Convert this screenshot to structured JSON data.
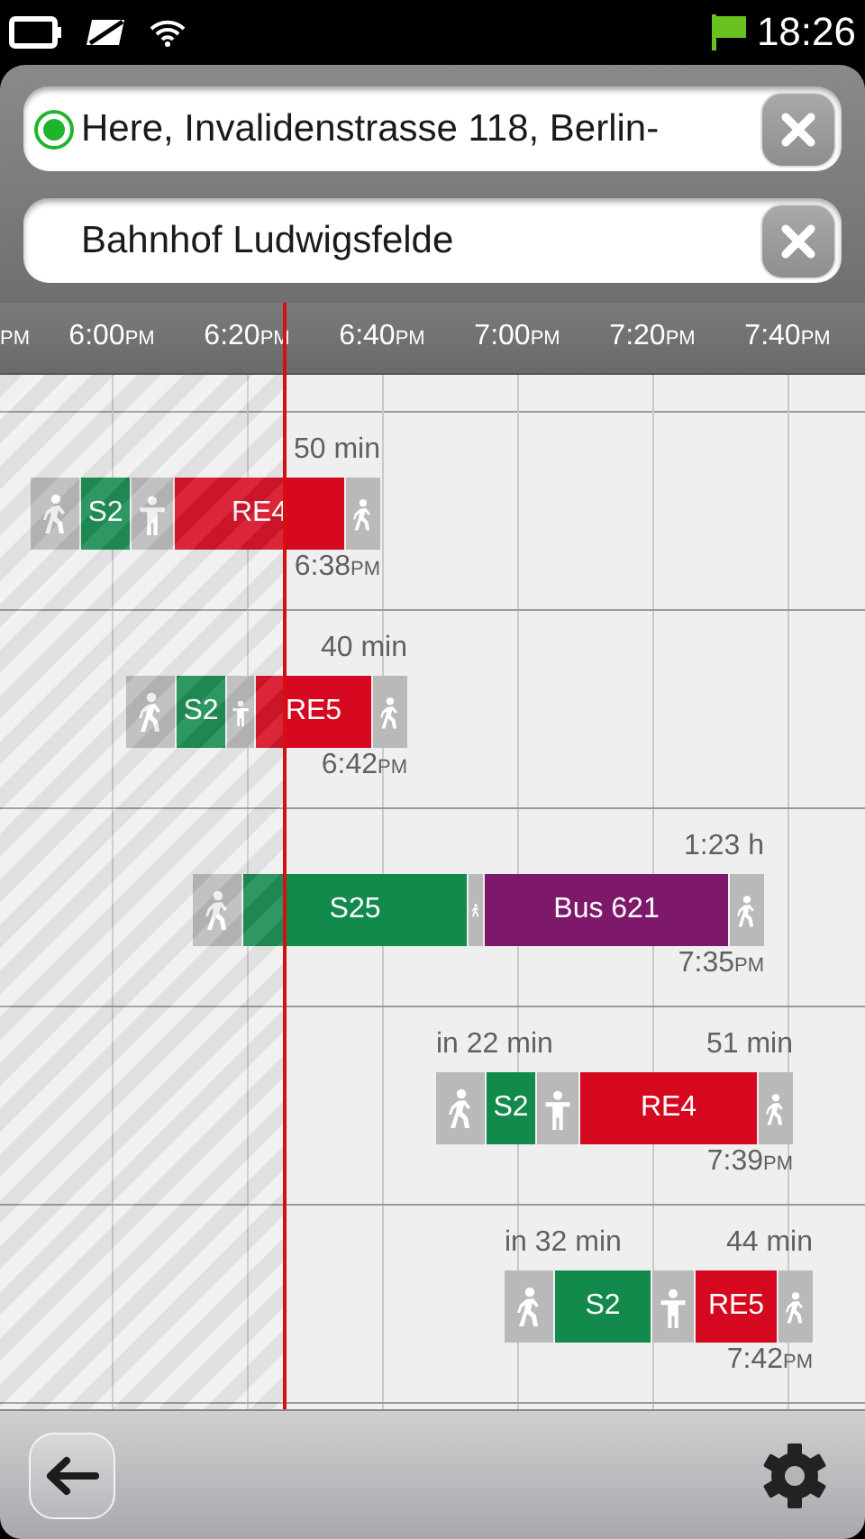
{
  "status_bar": {
    "time": "18:26"
  },
  "route": {
    "from": {
      "value": "Here, Invalidenstrasse 118, Berlin-",
      "current_location": true
    },
    "to": {
      "value": "Bahnhof Ludwigsfelde"
    }
  },
  "time_axis": [
    {
      "suffix": "PM"
    },
    {
      "time": "6:00",
      "suffix": "PM"
    },
    {
      "time": "6:20",
      "suffix": "PM"
    },
    {
      "time": "6:40",
      "suffix": "PM"
    },
    {
      "time": "7:00",
      "suffix": "PM"
    },
    {
      "time": "7:20",
      "suffix": "PM"
    },
    {
      "time": "7:40",
      "suffix": "PM"
    }
  ],
  "connections": [
    {
      "duration": "50 min",
      "arrival": "6:38",
      "arrival_suffix": "PM",
      "legs": [
        {
          "kind": "walk"
        },
        {
          "kind": "line",
          "label": "S2",
          "color": "#128a4c"
        },
        {
          "kind": "transfer"
        },
        {
          "kind": "line",
          "label": "RE4",
          "color": "#d6081f"
        },
        {
          "kind": "walk"
        }
      ]
    },
    {
      "duration": "40 min",
      "arrival": "6:42",
      "arrival_suffix": "PM",
      "legs": [
        {
          "kind": "walk"
        },
        {
          "kind": "line",
          "label": "S2",
          "color": "#128a4c"
        },
        {
          "kind": "transfer"
        },
        {
          "kind": "line",
          "label": "RE5",
          "color": "#d6081f"
        },
        {
          "kind": "walk"
        }
      ]
    },
    {
      "duration": "1:23 h",
      "arrival": "7:35",
      "arrival_suffix": "PM",
      "legs": [
        {
          "kind": "walk"
        },
        {
          "kind": "line",
          "label": "S25",
          "color": "#128a4c"
        },
        {
          "kind": "walk"
        },
        {
          "kind": "line",
          "label": "Bus 621",
          "color": "#7d186b"
        },
        {
          "kind": "walk"
        }
      ]
    },
    {
      "departs_in": "in 22 min",
      "duration": "51 min",
      "arrival": "7:39",
      "arrival_suffix": "PM",
      "legs": [
        {
          "kind": "walk"
        },
        {
          "kind": "line",
          "label": "S2",
          "color": "#128a4c"
        },
        {
          "kind": "transfer"
        },
        {
          "kind": "line",
          "label": "RE4",
          "color": "#d6081f"
        },
        {
          "kind": "walk"
        }
      ]
    },
    {
      "departs_in": "in 32 min",
      "duration": "44 min",
      "arrival": "7:42",
      "arrival_suffix": "PM",
      "legs": [
        {
          "kind": "walk"
        },
        {
          "kind": "line",
          "label": "S2",
          "color": "#128a4c"
        },
        {
          "kind": "transfer"
        },
        {
          "kind": "line",
          "label": "RE5",
          "color": "#d6081f"
        },
        {
          "kind": "walk"
        }
      ]
    }
  ]
}
